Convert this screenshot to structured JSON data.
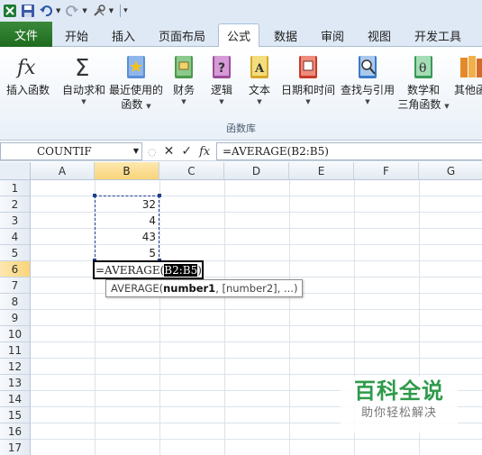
{
  "quick_access": {
    "items": [
      "excel-logo",
      "save",
      "undo",
      "redo",
      "tools",
      "customize"
    ]
  },
  "tabs": [
    {
      "label": "文件",
      "name": "tab-file"
    },
    {
      "label": "开始",
      "name": "tab-home"
    },
    {
      "label": "插入",
      "name": "tab-insert"
    },
    {
      "label": "页面布局",
      "name": "tab-page-layout"
    },
    {
      "label": "公式",
      "name": "tab-formulas",
      "active": true
    },
    {
      "label": "数据",
      "name": "tab-data"
    },
    {
      "label": "审阅",
      "name": "tab-review"
    },
    {
      "label": "视图",
      "name": "tab-view"
    },
    {
      "label": "开发工具",
      "name": "tab-developer"
    }
  ],
  "ribbon": {
    "group_label": "函数库",
    "buttons": [
      {
        "line1": "插入函数",
        "line2": "",
        "caret": false
      },
      {
        "line1": "自动求和",
        "line2": "",
        "caret": true
      },
      {
        "line1": "最近使用的",
        "line2": "函数",
        "caret": true
      },
      {
        "line1": "财务",
        "line2": "",
        "caret": true
      },
      {
        "line1": "逻辑",
        "line2": "",
        "caret": true
      },
      {
        "line1": "文本",
        "line2": "",
        "caret": true
      },
      {
        "line1": "日期和时间",
        "line2": "",
        "caret": true
      },
      {
        "line1": "查找与引用",
        "line2": "",
        "caret": true
      },
      {
        "line1": "数学和",
        "line2": "三角函数",
        "caret": true
      },
      {
        "line1": "其他函",
        "line2": "",
        "caret": false
      }
    ]
  },
  "formula_bar": {
    "name_box": "COUNTIF",
    "fx_label": "fx",
    "formula": "=AVERAGE(B2:B5)"
  },
  "sheet": {
    "columns": [
      "A",
      "B",
      "C",
      "D",
      "E",
      "F",
      "G"
    ],
    "selected_column": "B",
    "rows": [
      "1",
      "2",
      "3",
      "4",
      "5",
      "6",
      "7",
      "8",
      "9",
      "10",
      "11",
      "12",
      "13",
      "14",
      "15",
      "16",
      "17"
    ],
    "selected_row": "6",
    "values": {
      "B2": "32",
      "B3": "4",
      "B4": "43",
      "B5": "5"
    },
    "edit_cell": {
      "address": "B6",
      "prefix": "=AVERAGE(",
      "highlight": "B2:B5",
      "suffix": ")"
    }
  },
  "tooltip": {
    "fn": "AVERAGE(",
    "arg1": "number1",
    "rest": ", [number2], ...)"
  },
  "watermark": {
    "title": "百科全说",
    "subtitle": "助你轻松解决"
  }
}
